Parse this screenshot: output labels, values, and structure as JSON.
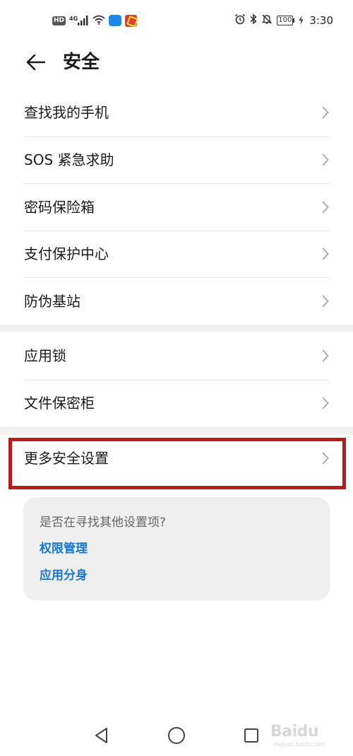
{
  "status_bar": {
    "left_icons": [
      "hd-icon",
      "4g-signal-icon",
      "wifi-icon",
      "blue-app-icon",
      "red-app-icon"
    ],
    "hd": "HD",
    "network": "4G",
    "right_icons": [
      "alarm-icon",
      "bluetooth-icon",
      "mute-bell-icon",
      "battery-icon"
    ],
    "battery": "100",
    "time": "3:30"
  },
  "header": {
    "back_icon": "back-arrow-icon",
    "title": "安全"
  },
  "groups": [
    {
      "items": [
        {
          "label": "查找我的手机"
        },
        {
          "label": "SOS 紧急求助"
        },
        {
          "label": "密码保险箱"
        },
        {
          "label": "支付保护中心"
        },
        {
          "label": "防伪基站"
        }
      ]
    },
    {
      "items": [
        {
          "label": "应用锁"
        },
        {
          "label": "文件保密柜"
        }
      ]
    },
    {
      "items": [
        {
          "label": "更多安全设置"
        }
      ]
    }
  ],
  "suggestion": {
    "question": "是否在寻找其他设置项?",
    "links": [
      "权限管理",
      "应用分身"
    ]
  },
  "colors": {
    "accent_link": "#1877d1",
    "highlight_border": "#b41d1d",
    "card_bg": "#efefef",
    "separator_band": "#f1f1f1"
  },
  "watermark": {
    "text": "Baidu",
    "sub": "jingyan.baidu.com"
  }
}
